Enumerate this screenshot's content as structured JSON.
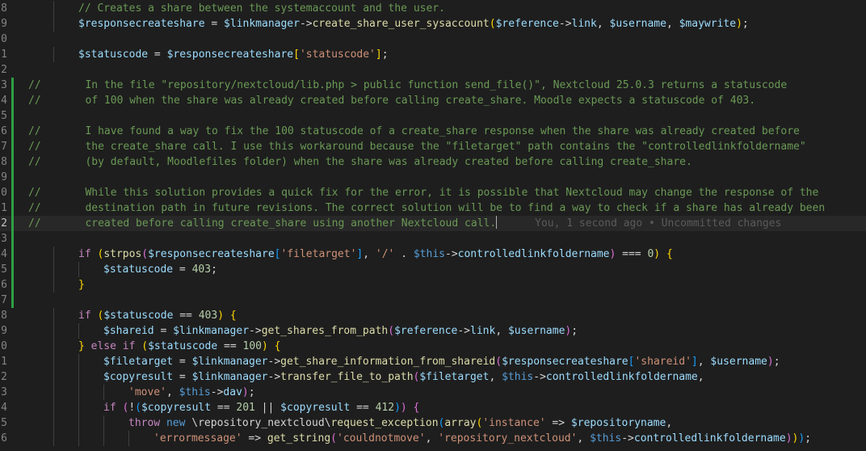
{
  "editor": {
    "line_numbers": [
      "8",
      "9",
      "0",
      "1",
      "2",
      "3",
      "4",
      "5",
      "6",
      "7",
      "8",
      "9",
      "0",
      "1",
      "2",
      "3",
      "4",
      "5",
      "6",
      "7",
      "8",
      "9",
      "0",
      "1",
      "2",
      "3",
      "4",
      "5",
      "6"
    ],
    "current_line_index": 14,
    "modified_line_indices": [
      5,
      6,
      7,
      8,
      9,
      10,
      11,
      12,
      13,
      14,
      15,
      16,
      17,
      18,
      19
    ],
    "lines": [
      {
        "indent": 2,
        "tokens": [
          [
            "cm",
            "// Creates a share between the systemaccount and the user."
          ]
        ]
      },
      {
        "indent": 2,
        "tokens": [
          [
            "var",
            "$responsecreateshare"
          ],
          [
            "op",
            " = "
          ],
          [
            "var",
            "$linkmanager"
          ],
          [
            "op",
            "->"
          ],
          [
            "fn",
            "create_share_user_sysaccount"
          ],
          [
            "b1",
            "("
          ],
          [
            "var",
            "$reference"
          ],
          [
            "op",
            "->"
          ],
          [
            "var",
            "link"
          ],
          [
            "op",
            ", "
          ],
          [
            "var",
            "$username"
          ],
          [
            "op",
            ", "
          ],
          [
            "var",
            "$maywrite"
          ],
          [
            "b1",
            ")"
          ],
          [
            "op",
            ";"
          ]
        ]
      },
      {
        "indent": 0,
        "tokens": []
      },
      {
        "indent": 2,
        "tokens": [
          [
            "var",
            "$statuscode"
          ],
          [
            "op",
            " = "
          ],
          [
            "var",
            "$responsecreateshare"
          ],
          [
            "b1",
            "["
          ],
          [
            "str",
            "'statuscode'"
          ],
          [
            "b1",
            "]"
          ],
          [
            "op",
            ";"
          ]
        ]
      },
      {
        "indent": 0,
        "tokens": []
      },
      {
        "indent": 0,
        "tokens": [
          [
            "cm",
            "//       In the file \"repository/nextcloud/lib.php > public function send_file()\", Nextcloud 25.0.3 returns a statuscode"
          ]
        ]
      },
      {
        "indent": 0,
        "tokens": [
          [
            "cm",
            "//       of 100 when the share was already created before calling create_share. Moodle expects a statuscode of 403."
          ]
        ]
      },
      {
        "indent": 0,
        "tokens": []
      },
      {
        "indent": 0,
        "tokens": [
          [
            "cm",
            "//       I have found a way to fix the 100 statuscode of a create_share response when the share was already created before"
          ]
        ]
      },
      {
        "indent": 0,
        "tokens": [
          [
            "cm",
            "//       the create_share call. I use this workaround because the \"filetarget\" path contains the \"controlledlinkfoldername\""
          ]
        ]
      },
      {
        "indent": 0,
        "tokens": [
          [
            "cm",
            "//       (by default, Moodlefiles folder) when the share was already created before calling create_share."
          ]
        ]
      },
      {
        "indent": 0,
        "tokens": []
      },
      {
        "indent": 0,
        "tokens": [
          [
            "cm",
            "//       While this solution provides a quick fix for the error, it is possible that Nextcloud may change the response of the"
          ]
        ]
      },
      {
        "indent": 0,
        "tokens": [
          [
            "cm",
            "//       destination path in future revisions. The correct solution will be to find a way to check if a share has already been"
          ]
        ]
      },
      {
        "indent": 0,
        "tokens": [
          [
            "cm",
            "//       created before calling create_share using another Nextcloud call."
          ],
          [
            "caret",
            ""
          ],
          [
            "blame",
            "      You, 1 second ago • Uncommitted changes"
          ]
        ]
      },
      {
        "indent": 0,
        "tokens": []
      },
      {
        "indent": 2,
        "tokens": [
          [
            "kw",
            "if"
          ],
          [
            "op",
            " "
          ],
          [
            "b1",
            "("
          ],
          [
            "fn",
            "strpos"
          ],
          [
            "b2",
            "("
          ],
          [
            "var",
            "$responsecreateshare"
          ],
          [
            "b3",
            "["
          ],
          [
            "str",
            "'filetarget'"
          ],
          [
            "b3",
            "]"
          ],
          [
            "op",
            ", "
          ],
          [
            "str",
            "'/'"
          ],
          [
            "op",
            " . "
          ],
          [
            "kw2",
            "$this"
          ],
          [
            "op",
            "->"
          ],
          [
            "var",
            "controlledlinkfoldername"
          ],
          [
            "b2",
            ")"
          ],
          [
            "op",
            " === "
          ],
          [
            "num",
            "0"
          ],
          [
            "b1",
            ")"
          ],
          [
            "op",
            " "
          ],
          [
            "b1",
            "{"
          ]
        ]
      },
      {
        "indent": 3,
        "tokens": [
          [
            "var",
            "$statuscode"
          ],
          [
            "op",
            " = "
          ],
          [
            "num",
            "403"
          ],
          [
            "op",
            ";"
          ]
        ]
      },
      {
        "indent": 2,
        "tokens": [
          [
            "b1",
            "}"
          ]
        ]
      },
      {
        "indent": 0,
        "tokens": []
      },
      {
        "indent": 2,
        "tokens": [
          [
            "kw",
            "if"
          ],
          [
            "op",
            " "
          ],
          [
            "b1",
            "("
          ],
          [
            "var",
            "$statuscode"
          ],
          [
            "op",
            " == "
          ],
          [
            "num",
            "403"
          ],
          [
            "b1",
            ")"
          ],
          [
            "op",
            " "
          ],
          [
            "b1",
            "{"
          ]
        ]
      },
      {
        "indent": 3,
        "tokens": [
          [
            "var",
            "$shareid"
          ],
          [
            "op",
            " = "
          ],
          [
            "var",
            "$linkmanager"
          ],
          [
            "op",
            "->"
          ],
          [
            "fn",
            "get_shares_from_path"
          ],
          [
            "b2",
            "("
          ],
          [
            "var",
            "$reference"
          ],
          [
            "op",
            "->"
          ],
          [
            "var",
            "link"
          ],
          [
            "op",
            ", "
          ],
          [
            "var",
            "$username"
          ],
          [
            "b2",
            ")"
          ],
          [
            "op",
            ";"
          ]
        ]
      },
      {
        "indent": 2,
        "tokens": [
          [
            "b1",
            "}"
          ],
          [
            "op",
            " "
          ],
          [
            "kw",
            "else if"
          ],
          [
            "op",
            " "
          ],
          [
            "b1",
            "("
          ],
          [
            "var",
            "$statuscode"
          ],
          [
            "op",
            " == "
          ],
          [
            "num",
            "100"
          ],
          [
            "b1",
            ")"
          ],
          [
            "op",
            " "
          ],
          [
            "b1",
            "{"
          ]
        ]
      },
      {
        "indent": 3,
        "tokens": [
          [
            "var",
            "$filetarget"
          ],
          [
            "op",
            " = "
          ],
          [
            "var",
            "$linkmanager"
          ],
          [
            "op",
            "->"
          ],
          [
            "fn",
            "get_share_information_from_shareid"
          ],
          [
            "b2",
            "("
          ],
          [
            "var",
            "$responsecreateshare"
          ],
          [
            "b3",
            "["
          ],
          [
            "str",
            "'shareid'"
          ],
          [
            "b3",
            "]"
          ],
          [
            "op",
            ", "
          ],
          [
            "var",
            "$username"
          ],
          [
            "b2",
            ")"
          ],
          [
            "op",
            ";"
          ]
        ]
      },
      {
        "indent": 3,
        "tokens": [
          [
            "var",
            "$copyresult"
          ],
          [
            "op",
            " = "
          ],
          [
            "var",
            "$linkmanager"
          ],
          [
            "op",
            "->"
          ],
          [
            "fn",
            "transfer_file_to_path"
          ],
          [
            "b2",
            "("
          ],
          [
            "var",
            "$filetarget"
          ],
          [
            "op",
            ", "
          ],
          [
            "kw2",
            "$this"
          ],
          [
            "op",
            "->"
          ],
          [
            "var",
            "controlledlinkfoldername"
          ],
          [
            "op",
            ","
          ]
        ]
      },
      {
        "indent": 4,
        "tokens": [
          [
            "str",
            "'move'"
          ],
          [
            "op",
            ", "
          ],
          [
            "kw2",
            "$this"
          ],
          [
            "op",
            "->"
          ],
          [
            "var",
            "dav"
          ],
          [
            "b2",
            ")"
          ],
          [
            "op",
            ";"
          ]
        ]
      },
      {
        "indent": 3,
        "tokens": [
          [
            "kw",
            "if"
          ],
          [
            "op",
            " "
          ],
          [
            "b2",
            "("
          ],
          [
            "op",
            "!"
          ],
          [
            "b3",
            "("
          ],
          [
            "var",
            "$copyresult"
          ],
          [
            "op",
            " == "
          ],
          [
            "num",
            "201"
          ],
          [
            "op",
            " || "
          ],
          [
            "var",
            "$copyresult"
          ],
          [
            "op",
            " == "
          ],
          [
            "num",
            "412"
          ],
          [
            "b3",
            ")"
          ],
          [
            "b2",
            ")"
          ],
          [
            "op",
            " "
          ],
          [
            "b2",
            "{"
          ]
        ]
      },
      {
        "indent": 4,
        "tokens": [
          [
            "kw",
            "throw"
          ],
          [
            "op",
            " "
          ],
          [
            "kw2",
            "new"
          ],
          [
            "op",
            " "
          ],
          [
            "cls",
            "\\repository_nextcloud\\"
          ],
          [
            "fn",
            "request_exception"
          ],
          [
            "b3",
            "("
          ],
          [
            "fn",
            "array"
          ],
          [
            "b1",
            "("
          ],
          [
            "str",
            "'instance'"
          ],
          [
            "op",
            " => "
          ],
          [
            "var",
            "$repositoryname"
          ],
          [
            "op",
            ","
          ]
        ]
      },
      {
        "indent": 5,
        "tokens": [
          [
            "str",
            "'errormessage'"
          ],
          [
            "op",
            " => "
          ],
          [
            "fn",
            "get_string"
          ],
          [
            "b2",
            "("
          ],
          [
            "str",
            "'couldnotmove'"
          ],
          [
            "op",
            ", "
          ],
          [
            "str",
            "'repository_nextcloud'"
          ],
          [
            "op",
            ", "
          ],
          [
            "kw2",
            "$this"
          ],
          [
            "op",
            "->"
          ],
          [
            "var",
            "controlledlinkfoldername"
          ],
          [
            "b2",
            ")"
          ],
          [
            "b1",
            ")"
          ],
          [
            "b3",
            ")"
          ],
          [
            "op",
            ";"
          ]
        ]
      }
    ]
  }
}
